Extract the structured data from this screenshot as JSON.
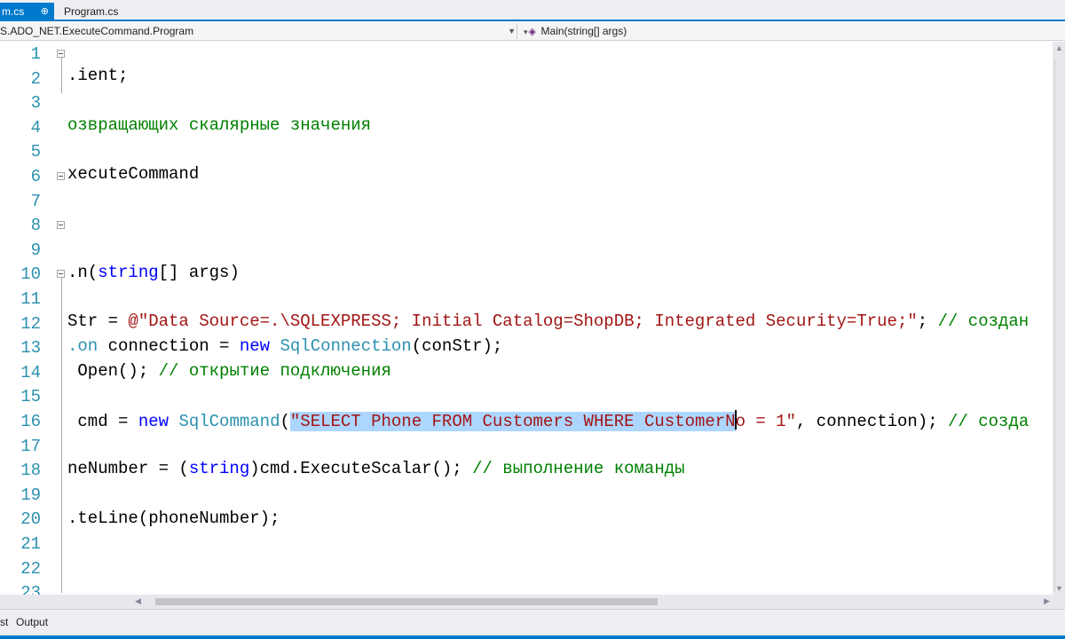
{
  "tabs": {
    "active_label": "m.cs",
    "active_pin": "⊕",
    "inactive_label": "Program.cs"
  },
  "navbar": {
    "type_combo": "S.ADO_NET.ExecuteCommand.Program",
    "member_combo": "Main(string[] args)",
    "member_icon": "method-cube-icon"
  },
  "lines": [
    {
      "n": "1"
    },
    {
      "n": "2"
    },
    {
      "n": "3"
    },
    {
      "n": "4"
    },
    {
      "n": "5"
    },
    {
      "n": "6"
    },
    {
      "n": "7"
    },
    {
      "n": "8"
    },
    {
      "n": "9"
    },
    {
      "n": "10"
    },
    {
      "n": "11"
    },
    {
      "n": "12"
    },
    {
      "n": "13"
    },
    {
      "n": "14"
    },
    {
      "n": "15"
    },
    {
      "n": "16"
    },
    {
      "n": "17"
    },
    {
      "n": "18"
    },
    {
      "n": "19"
    },
    {
      "n": "20"
    },
    {
      "n": "21"
    },
    {
      "n": "22"
    },
    {
      "n": "23"
    }
  ],
  "code": {
    "l2": ".ient;",
    "l4": "озвращающих скалярные значения",
    "l6": "xecuteCommand",
    "l10_a": ".n(",
    "l10_kw": "string",
    "l10_b": "[] args)",
    "l12_a": "Str = ",
    "l12_str": "@\"Data Source=.\\SQLEXPRESS; Initial Catalog=ShopDB; Integrated Security=True;\"",
    "l12_b": "; ",
    "l12_cm": "// создан",
    "l13_ty": ".on",
    "l13_a": " connection = ",
    "l13_kw": "new",
    "l13_b": " ",
    "l13_ty2": "SqlConnection",
    "l13_c": "(conStr);",
    "l14_a": " Open(); ",
    "l14_cm": "// открытие подключения",
    "l16_a": " cmd = ",
    "l16_kw": "new",
    "l16_b": " ",
    "l16_ty": "SqlCommand",
    "l16_c": "(",
    "l16_sel": "\"SELECT Phone FROM Customers WHERE CustomerN",
    "l16_str2": "o = 1\"",
    "l16_d": ", connection); ",
    "l16_cm": "// созда",
    "l18_a": "neNumber = (",
    "l18_kw": "string",
    "l18_b": ")cmd.ExecuteScalar(); ",
    "l18_cm": "// выполнение команды",
    "l20": ".teLine(phoneNumber);"
  },
  "bottom": {
    "tab_left": "st",
    "tab_output": "Output"
  },
  "colors": {
    "accent": "#007acc",
    "keyword": "#0000ff",
    "type": "#2b91af",
    "string": "#a31515",
    "comment": "#008000",
    "selection": "#add6ff"
  }
}
